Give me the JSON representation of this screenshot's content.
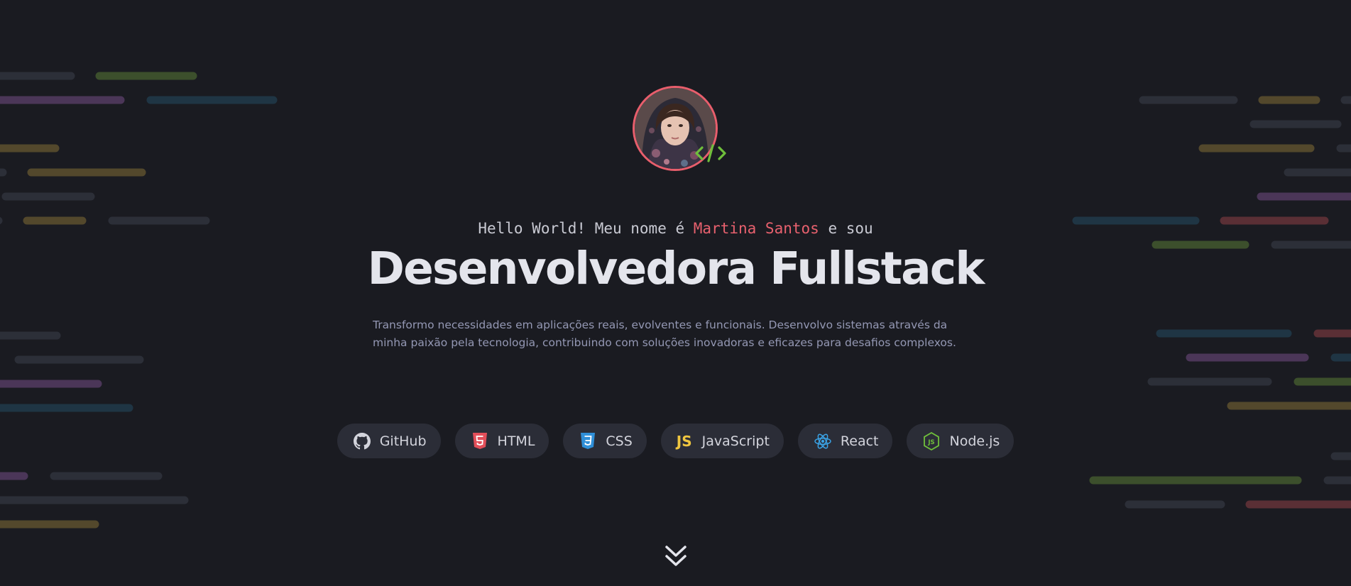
{
  "greeting": {
    "prefix": "Hello World! Meu nome é",
    "name": "Martina Santos",
    "suffix": "e sou"
  },
  "title": "Desenvolvedora Fullstack",
  "description": {
    "line1": "Transformo necessidades em aplicações reais, evolventes e funcionais. Desenvolvo sistemas através da",
    "line2": "minha paixão pela tecnologia, contribuindo com soluções inovadoras e eficazes para desafios complexos."
  },
  "tags": [
    {
      "label": "GitHub",
      "icon": "github-icon"
    },
    {
      "label": "HTML",
      "icon": "html5-icon"
    },
    {
      "label": "CSS",
      "icon": "css3-icon"
    },
    {
      "label": "JavaScript",
      "icon": "js-icon",
      "icon_text": "JS"
    },
    {
      "label": "React",
      "icon": "react-icon"
    },
    {
      "label": "Node.js",
      "icon": "nodejs-icon"
    }
  ],
  "colors": {
    "background": "#1a1b21",
    "accent": "#e8616e",
    "title": "#e4e5ec",
    "code_badge": "#6fbf3b",
    "tag_background": "#2b2d37"
  }
}
